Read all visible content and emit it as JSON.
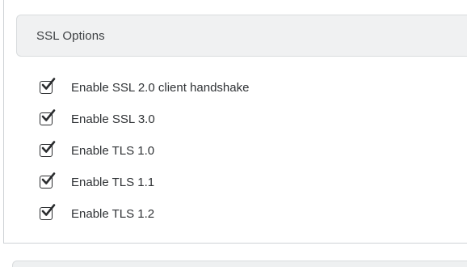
{
  "panel": {
    "title": "SSL Options",
    "options": [
      {
        "label": "Enable SSL 2.0 client handshake",
        "checked": true
      },
      {
        "label": "Enable SSL 3.0",
        "checked": true
      },
      {
        "label": "Enable TLS 1.0",
        "checked": true
      },
      {
        "label": "Enable TLS 1.1",
        "checked": true
      },
      {
        "label": "Enable TLS 1.2",
        "checked": true
      }
    ]
  },
  "colors": {
    "header_bg": "#f0f1f2",
    "border": "#d9dcde",
    "text": "#2f3235",
    "check": "#2a2c2e"
  }
}
